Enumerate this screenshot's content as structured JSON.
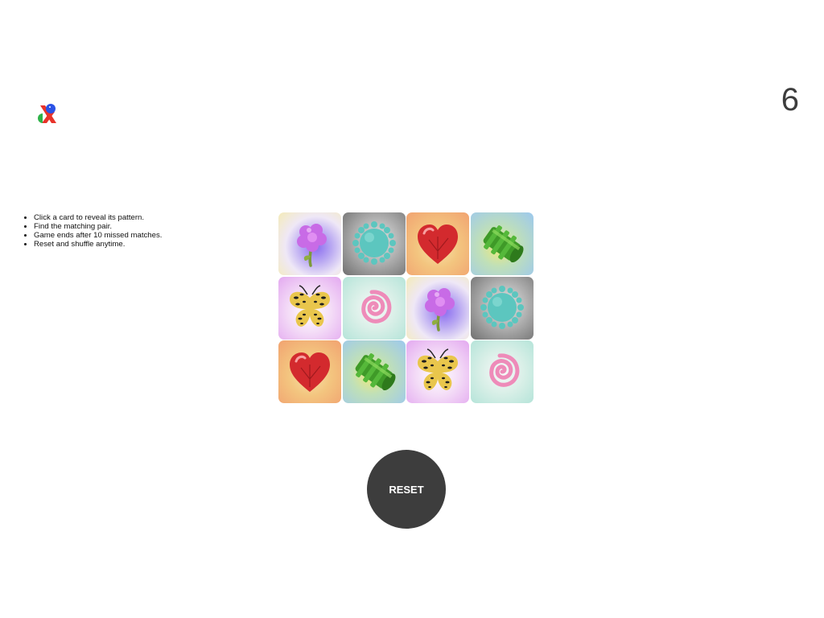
{
  "header": {
    "logo_icon": "abstract-shapes-logo",
    "counter": "6"
  },
  "instructions": [
    "Click a card to reveal its pattern.",
    "Find the matching pair.",
    "Game ends after 10 missed matches.",
    "Reset and shuffle anytime."
  ],
  "board": {
    "rows": 3,
    "columns": 4,
    "cards": [
      {
        "pattern": "flower-icon"
      },
      {
        "pattern": "spiky-ball-icon"
      },
      {
        "pattern": "heart-icon"
      },
      {
        "pattern": "green-tube-icon"
      },
      {
        "pattern": "butterfly-icon"
      },
      {
        "pattern": "spiral-icon"
      },
      {
        "pattern": "flower-icon"
      },
      {
        "pattern": "spiky-ball-icon"
      },
      {
        "pattern": "heart-icon"
      },
      {
        "pattern": "green-tube-icon"
      },
      {
        "pattern": "butterfly-icon"
      },
      {
        "pattern": "spiral-icon"
      }
    ]
  },
  "controls": {
    "reset_label": "RESET"
  },
  "colors": {
    "button": "#3d3d3d",
    "counter_text": "#3d3d3d",
    "logo_red": "#e8332a",
    "logo_blue": "#2b52e6",
    "logo_green": "#2fb34a"
  }
}
